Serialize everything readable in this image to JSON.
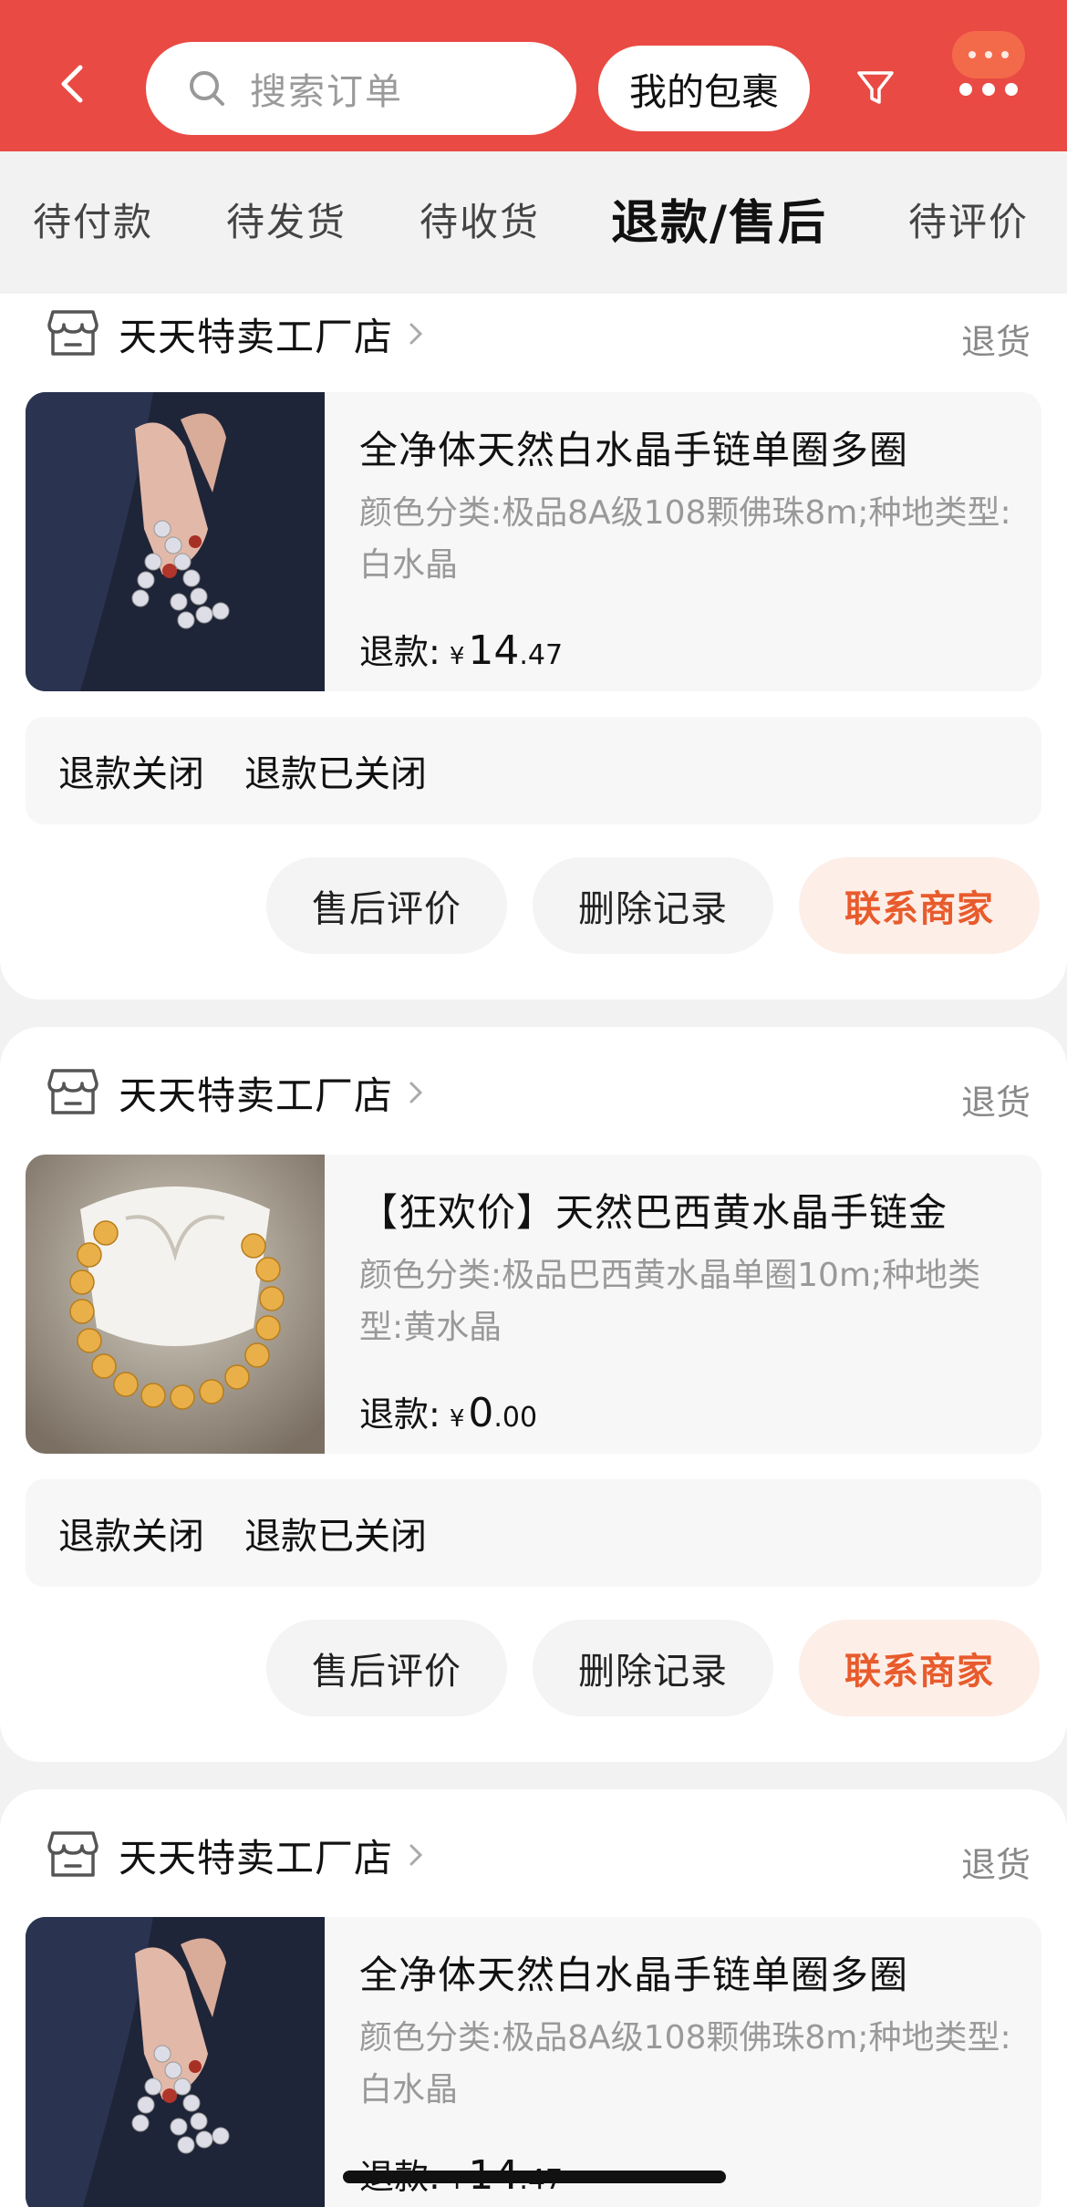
{
  "header": {
    "search_placeholder": "搜索订单",
    "parcel_label": "我的包裹",
    "accent_color": "#e94a43"
  },
  "tabs": [
    {
      "label": "待付款",
      "active": false
    },
    {
      "label": "待发货",
      "active": false
    },
    {
      "label": "待收货",
      "active": false
    },
    {
      "label": "退款/售后",
      "active": true
    },
    {
      "label": "待评价",
      "active": false
    }
  ],
  "orders": [
    {
      "shop": "天天特卖工厂店",
      "status": "退货",
      "title": "全净体天然白水晶手链单圈多圈",
      "spec": "颜色分类:极品8A级108颗佛珠8m;种地类型:白水晶",
      "refund_label": "退款:",
      "currency": "¥",
      "amount_int": "14",
      "amount_dec": ".47",
      "refund_state": "退款关闭",
      "refund_detail": "退款已关闭",
      "actions": [
        "售后评价",
        "删除记录",
        "联系商家"
      ]
    },
    {
      "shop": "天天特卖工厂店",
      "status": "退货",
      "title": "【狂欢价】天然巴西黄水晶手链金",
      "spec": "颜色分类:极品巴西黄水晶单圈10m;种地类型:黄水晶",
      "refund_label": "退款:",
      "currency": "¥",
      "amount_int": "0",
      "amount_dec": ".00",
      "refund_state": "退款关闭",
      "refund_detail": "退款已关闭",
      "actions": [
        "售后评价",
        "删除记录",
        "联系商家"
      ]
    },
    {
      "shop": "天天特卖工厂店",
      "status": "退货",
      "title": "全净体天然白水晶手链单圈多圈",
      "spec": "颜色分类:极品8A级108颗佛珠8m;种地类型:白水晶",
      "refund_label": "退款:",
      "currency": "¥",
      "amount_int": "14",
      "amount_dec": ".47"
    }
  ]
}
